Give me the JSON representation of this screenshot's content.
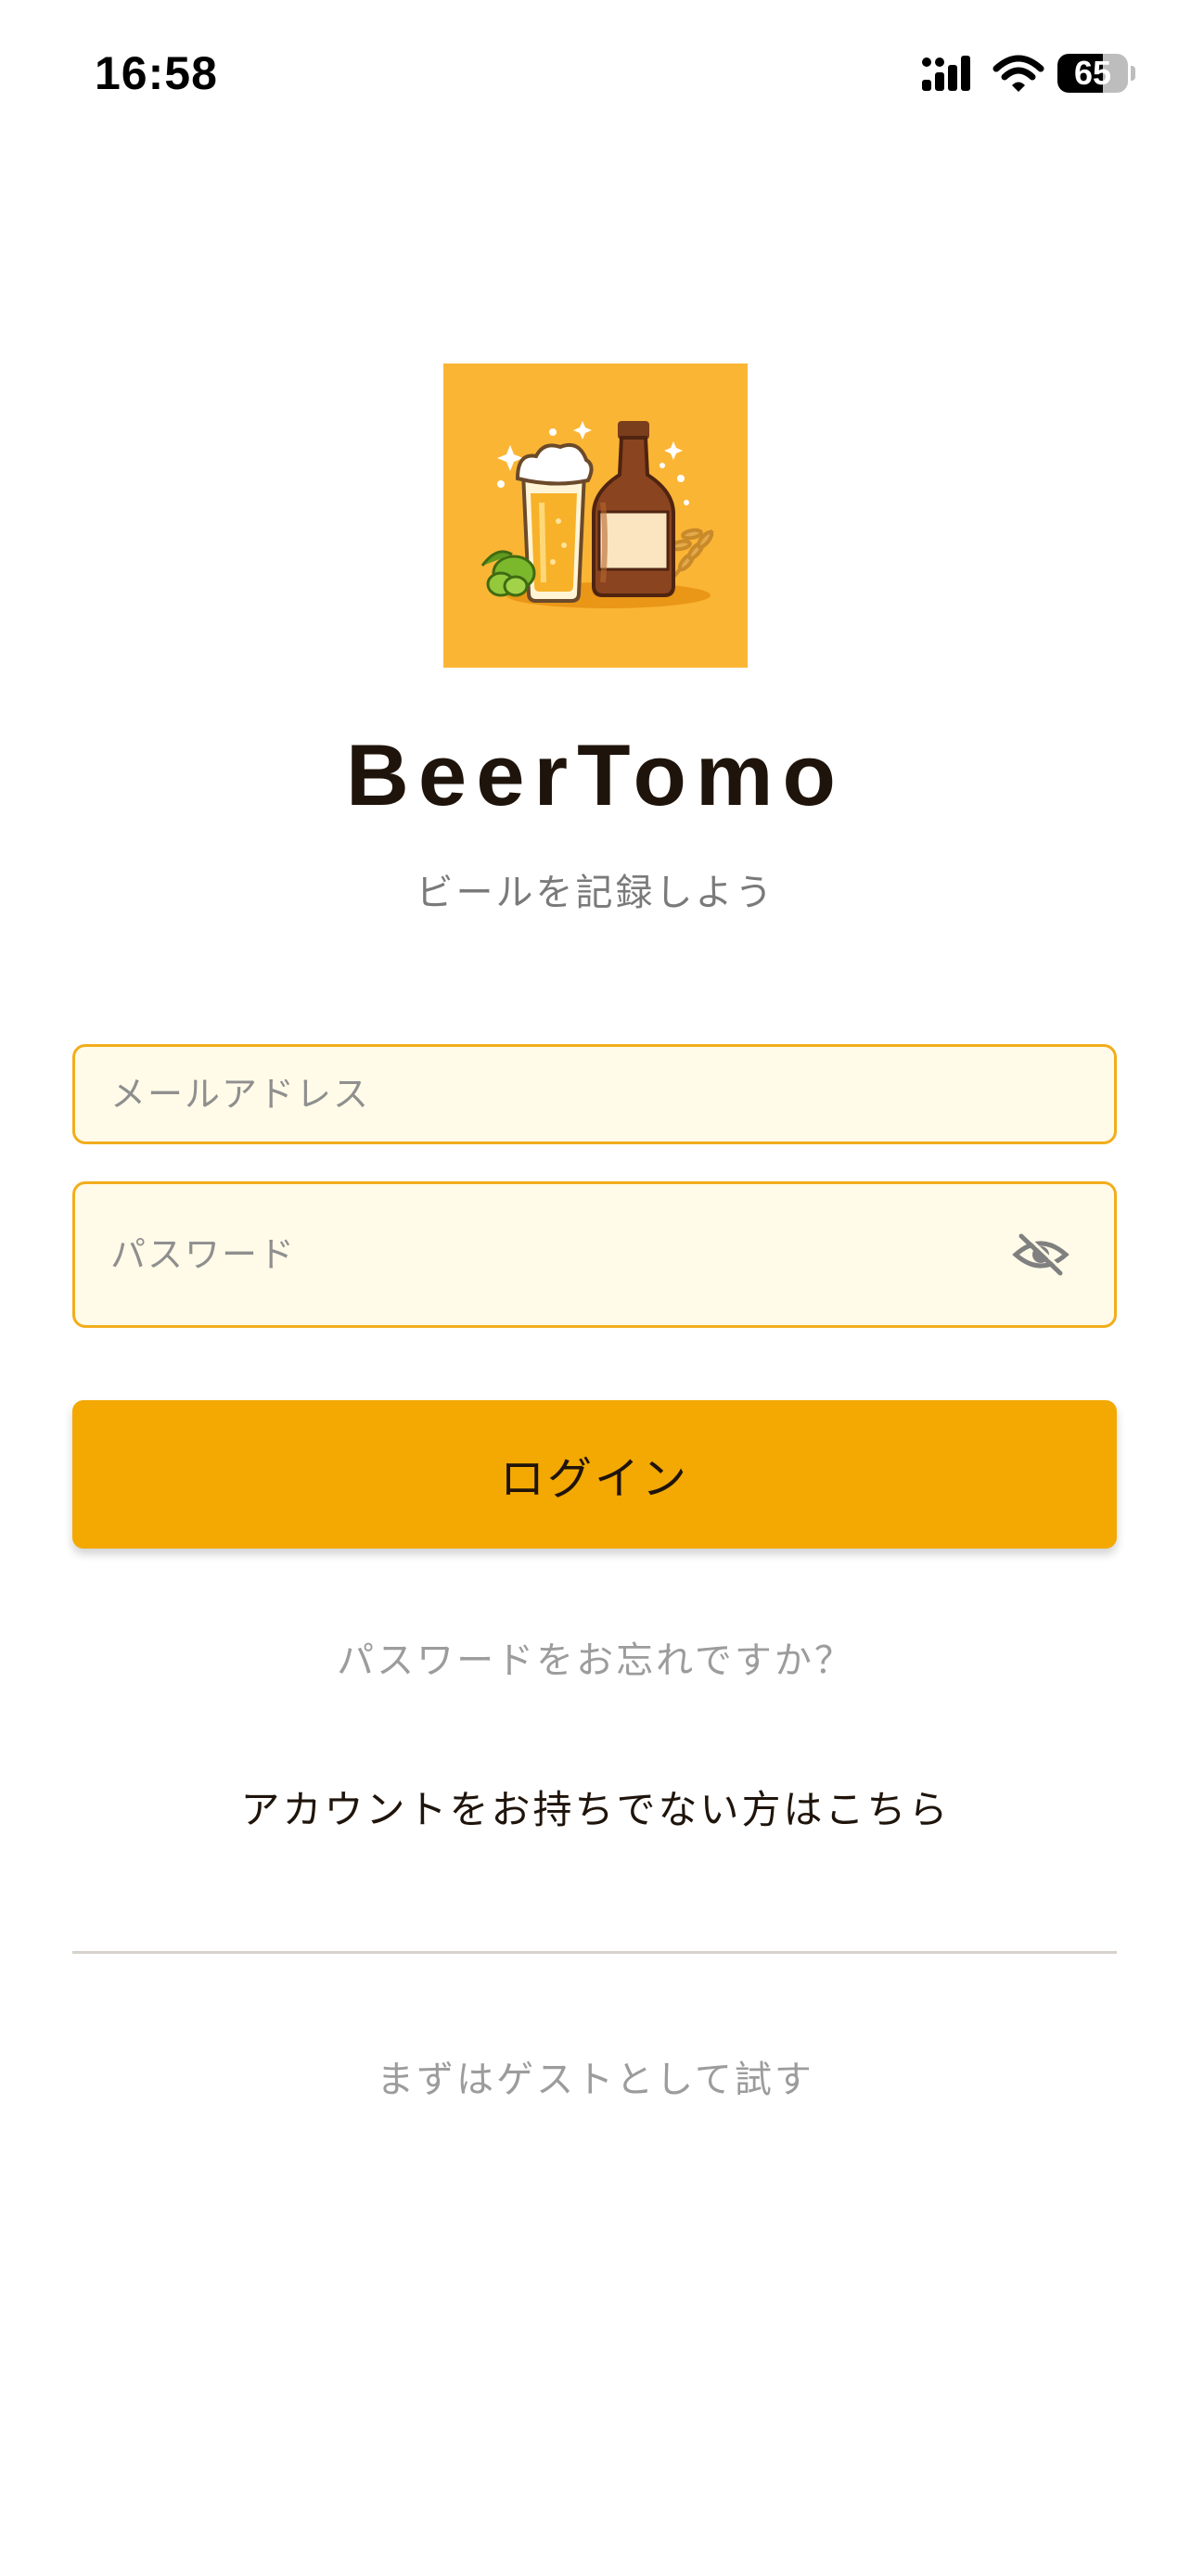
{
  "status_bar": {
    "time": "16:58",
    "battery": "65",
    "battery_level": 0.65
  },
  "brand": {
    "app_name": "BeerTomo",
    "tagline": "ビールを記録しよう",
    "logo_icon": "beer-glass-and-bottle-icon"
  },
  "form": {
    "email_placeholder": "メールアドレス",
    "password_placeholder": "パスワード",
    "password_toggle_icon": "eye-off-icon",
    "login_label": "ログイン"
  },
  "links": {
    "forgot_password": "パスワードをお忘れですか？",
    "signup": "アカウントをお持ちでない方はこちら",
    "guest": "まずはゲストとして試す"
  },
  "colors": {
    "accent": "#f3a802",
    "field_border": "#f2ad1c",
    "field_background": "#fffbe8",
    "logo_background": "#fbb535",
    "text_dark": "#1f140b"
  }
}
